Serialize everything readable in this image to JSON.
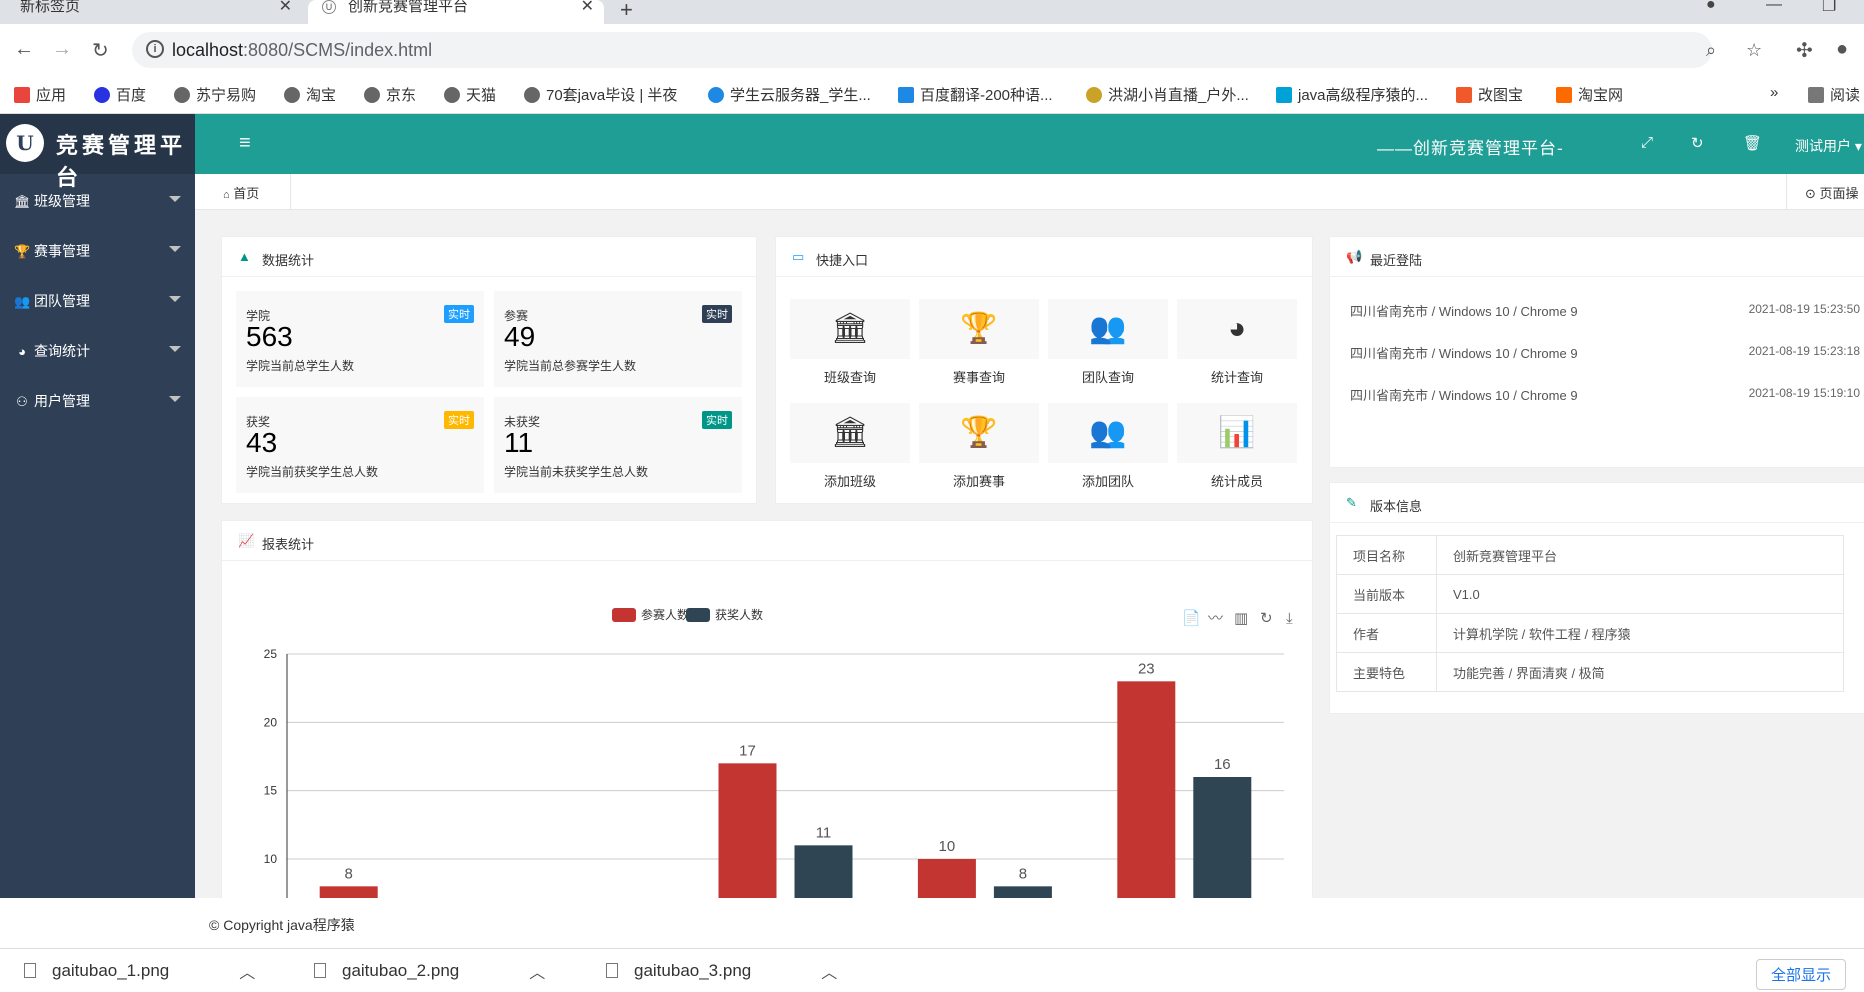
{
  "browser": {
    "tabs": [
      {
        "title": "新标签页"
      },
      {
        "title": "创新竞赛管理平台"
      }
    ],
    "url_host": "localhost",
    "url_rest": ":8080/SCMS/index.html",
    "bookmarks": [
      "应用",
      "百度",
      "苏宁易购",
      "淘宝",
      "京东",
      "天猫",
      "70套java毕设 | 半夜",
      "学生云服务器_学生...",
      "百度翻译-200种语...",
      "洪湖小肖直播_户外...",
      "java高级程序猿的...",
      "改图宝",
      "淘宝网"
    ],
    "reading_list": "阅读",
    "more": "»"
  },
  "app": {
    "logo_text": "竞赛管理平台",
    "menu": [
      {
        "label": "班级管理",
        "icon": "bank-icon"
      },
      {
        "label": "赛事管理",
        "icon": "trophy-icon"
      },
      {
        "label": "团队管理",
        "icon": "users-icon"
      },
      {
        "label": "查询统计",
        "icon": "pie-icon"
      },
      {
        "label": "用户管理",
        "icon": "user-icon"
      }
    ],
    "system_name": "——创新竞赛管理平台-",
    "user": "测试用户",
    "home_tab": "首页",
    "page_ops": "页面操",
    "footer": "© Copyright java程序猿"
  },
  "stats_card": {
    "title": "数据统计",
    "items": [
      {
        "label": "学院",
        "value": "563",
        "desc": "学院当前总学生人数",
        "badge": "实时",
        "badge_color": "#1e9fff"
      },
      {
        "label": "参赛",
        "value": "49",
        "desc": "学院当前总参赛学生人数",
        "badge": "实时",
        "badge_color": "#2f4056"
      },
      {
        "label": "获奖",
        "value": "43",
        "desc": "学院当前获奖学生总人数",
        "badge": "实时",
        "badge_color": "#ffb800"
      },
      {
        "label": "未获奖",
        "value": "11",
        "desc": "学院当前未获奖学生总人数",
        "badge": "实时",
        "badge_color": "#009688"
      }
    ]
  },
  "quick_card": {
    "title": "快捷入口",
    "items": [
      {
        "label": "班级查询",
        "icon": "bank-icon",
        "glyph": "🏛"
      },
      {
        "label": "赛事查询",
        "icon": "trophy-icon",
        "glyph": "🏆"
      },
      {
        "label": "团队查询",
        "icon": "users-icon",
        "glyph": "👥"
      },
      {
        "label": "统计查询",
        "icon": "pie-chart-icon",
        "glyph": "◕"
      },
      {
        "label": "添加班级",
        "icon": "bank-icon",
        "glyph": "🏛"
      },
      {
        "label": "添加赛事",
        "icon": "trophy-icon",
        "glyph": "🏆"
      },
      {
        "label": "添加团队",
        "icon": "users-icon",
        "glyph": "👥"
      },
      {
        "label": "统计成员",
        "icon": "bar-chart-icon",
        "glyph": "📊"
      }
    ]
  },
  "login_card": {
    "title": "最近登陆",
    "rows": [
      {
        "info": "四川省南充市 / Windows 10 / Chrome 9",
        "time": "2021-08-19 15:23:50"
      },
      {
        "info": "四川省南充市 / Windows 10 / Chrome 9",
        "time": "2021-08-19 15:23:18"
      },
      {
        "info": "四川省南充市 / Windows 10 / Chrome 9",
        "time": "2021-08-19 15:19:10"
      }
    ]
  },
  "version_card": {
    "title": "版本信息",
    "rows": [
      {
        "key": "项目名称",
        "value": "创新竞赛管理平台"
      },
      {
        "key": "当前版本",
        "value": "V1.0"
      },
      {
        "key": "作者",
        "value": "计算机学院 / 软件工程 / 程序猿"
      },
      {
        "key": "主要特色",
        "value": "功能完善 / 界面清爽 / 极简"
      }
    ]
  },
  "report_card": {
    "title": "报表统计"
  },
  "chart_data": {
    "type": "bar",
    "legend": [
      "参赛人数",
      "获奖人数"
    ],
    "colors": [
      "#c23531",
      "#2f4554"
    ],
    "ylim": [
      0,
      25
    ],
    "yticks": [
      10,
      15,
      20,
      25
    ],
    "categories": [
      "",
      "",
      "",
      "",
      ""
    ],
    "series": [
      {
        "name": "参赛人数",
        "values": [
          8,
          null,
          17,
          10,
          23
        ]
      },
      {
        "name": "获奖人数",
        "values": [
          null,
          null,
          11,
          8,
          16
        ]
      }
    ]
  },
  "downloads": [
    {
      "name": "gaitubao_1.png"
    },
    {
      "name": "gaitubao_2.png"
    },
    {
      "name": "gaitubao_3.png"
    }
  ],
  "show_all": "全部显示"
}
